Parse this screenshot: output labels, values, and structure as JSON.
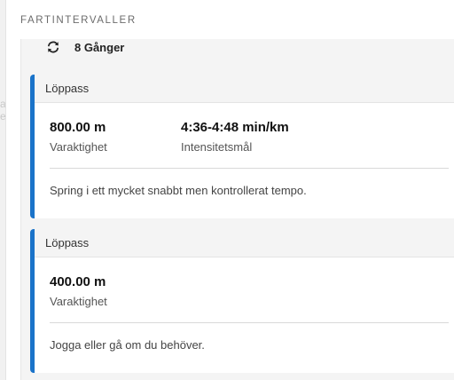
{
  "side_ghost_text": [
    "a",
    "e"
  ],
  "section": {
    "title": "FARTINTERVALLER",
    "repeat": {
      "icon": "repeat-icon",
      "label": "8 Gånger"
    }
  },
  "steps": [
    {
      "title": "Löppass",
      "distance_value": "800.00 m",
      "distance_label": "Varaktighet",
      "target_value": "4:36-4:48 min/km",
      "target_label": "Intensitetsmål",
      "description": "Spring i ett mycket snabbt men kontrollerat tempo."
    },
    {
      "title": "Löppass",
      "distance_value": "400.00 m",
      "distance_label": "Varaktighet",
      "description": "Jogga eller gå om du behöver."
    }
  ],
  "colors": {
    "accent": "#1a73c9"
  }
}
